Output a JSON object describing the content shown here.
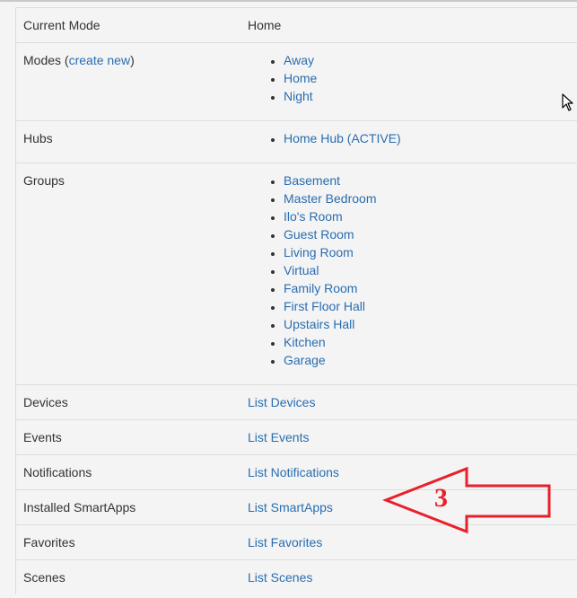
{
  "rows": {
    "current_mode": {
      "label": "Current Mode",
      "value": "Home"
    },
    "modes": {
      "label_prefix": "Modes (",
      "create_link": "create new",
      "label_suffix": ")",
      "items": [
        "Away",
        "Home",
        "Night"
      ]
    },
    "hubs": {
      "label": "Hubs",
      "items": [
        "Home Hub (ACTIVE)"
      ]
    },
    "groups": {
      "label": "Groups",
      "items": [
        "Basement",
        "Master Bedroom",
        "Ilo's Room",
        "Guest Room",
        "Living Room",
        "Virtual",
        "Family Room",
        "First Floor Hall",
        "Upstairs Hall",
        "Kitchen",
        "Garage"
      ]
    },
    "devices": {
      "label": "Devices",
      "link": "List Devices"
    },
    "events": {
      "label": "Events",
      "link": "List Events"
    },
    "notifications": {
      "label": "Notifications",
      "link": "List Notifications"
    },
    "smartapps": {
      "label": "Installed SmartApps",
      "link": "List SmartApps"
    },
    "favorites": {
      "label": "Favorites",
      "link": "List Favorites"
    },
    "scenes": {
      "label": "Scenes",
      "link": "List Scenes"
    }
  },
  "annotation": {
    "text": "3",
    "color": "#e8202a"
  },
  "colors": {
    "link": "#2a6db0",
    "text": "#333333",
    "border": "#dddddd",
    "background": "#f4f4f4"
  }
}
